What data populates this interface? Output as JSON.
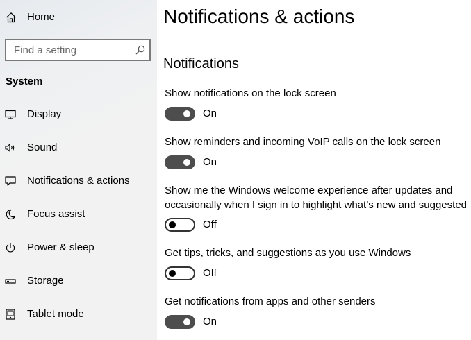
{
  "sidebar": {
    "home_label": "Home",
    "search_placeholder": "Find a setting",
    "section_heading": "System",
    "items": [
      {
        "label": "Display",
        "icon": "display-icon"
      },
      {
        "label": "Sound",
        "icon": "speaker-icon"
      },
      {
        "label": "Notifications & actions",
        "icon": "notification-icon"
      },
      {
        "label": "Focus assist",
        "icon": "moon-icon"
      },
      {
        "label": "Power & sleep",
        "icon": "power-icon"
      },
      {
        "label": "Storage",
        "icon": "storage-icon"
      },
      {
        "label": "Tablet mode",
        "icon": "tablet-icon"
      }
    ]
  },
  "main": {
    "title": "Notifications & actions",
    "section_heading": "Notifications",
    "settings": [
      {
        "label": "Show notifications on the lock screen",
        "state": "On",
        "on": true
      },
      {
        "label": "Show reminders and incoming VoIP calls on the lock screen",
        "state": "On",
        "on": true
      },
      {
        "label_line1": "Show me the Windows welcome experience after updates and",
        "label_line2": "occasionally when I sign in to highlight what’s new and suggested",
        "state": "Off",
        "on": false
      },
      {
        "label": "Get tips, tricks, and suggestions as you use Windows",
        "state": "Off",
        "on": false
      },
      {
        "label": "Get notifications from apps and other senders",
        "state": "On",
        "on": true
      }
    ]
  },
  "colors": {
    "toggle_on": "#4d4d4d",
    "toggle_off_border": "#333333",
    "sidebar_bg": "#f2f2f2"
  }
}
